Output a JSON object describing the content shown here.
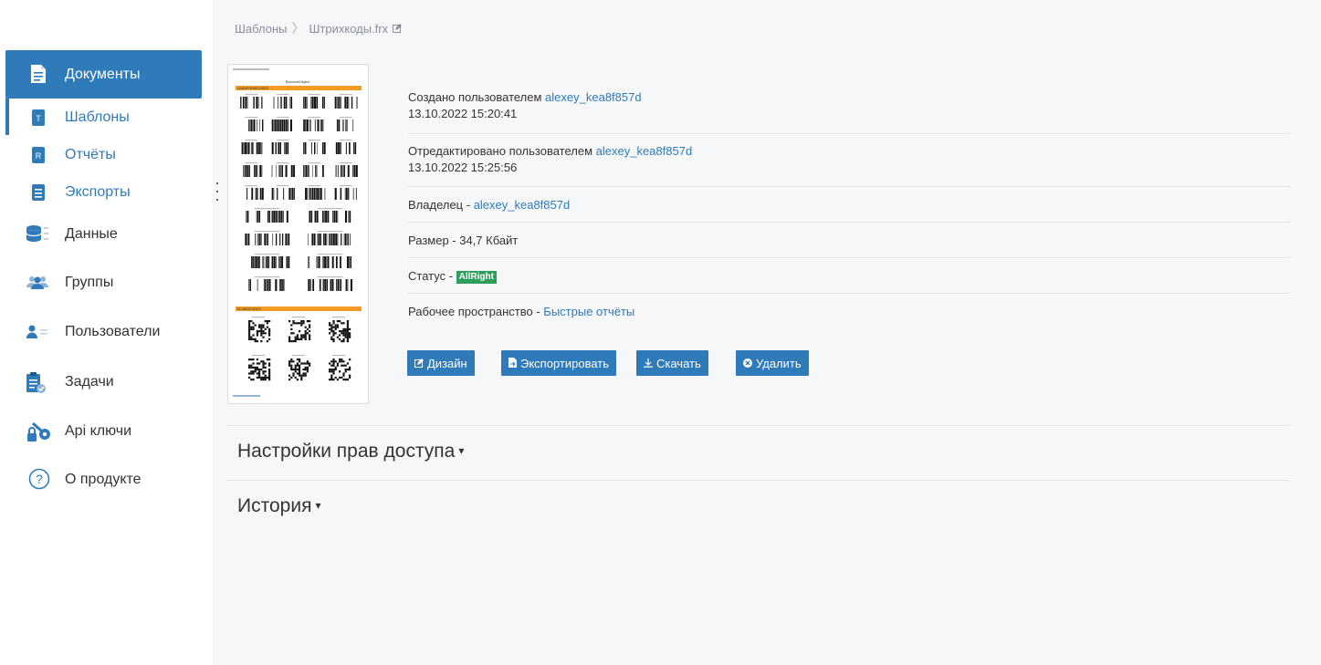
{
  "sidebar": {
    "documents": {
      "label": "Документы",
      "icon": "document-icon"
    },
    "sub_items": [
      {
        "label": "Шаблоны",
        "icon": "template-icon",
        "letter": "T"
      },
      {
        "label": "Отчёты",
        "icon": "report-icon",
        "letter": "R"
      },
      {
        "label": "Экспорты",
        "icon": "export-doc-icon"
      }
    ],
    "items": [
      {
        "label": "Данные",
        "icon": "database-icon"
      },
      {
        "label": "Группы",
        "icon": "group-icon"
      },
      {
        "label": "Пользователи",
        "icon": "users-icon"
      },
      {
        "label": "Задачи",
        "icon": "tasks-icon"
      },
      {
        "label": "Api ключи",
        "icon": "key-icon"
      },
      {
        "label": "О продукте",
        "icon": "question-icon",
        "question_mark": "?"
      }
    ]
  },
  "breadcrumb": {
    "root": "Шаблоны",
    "separator": "〉",
    "current": "Штрихкоды.frx"
  },
  "thumbnail": {
    "header": "BarcodeObject",
    "section1": "LINEAR BARCODES",
    "section2": "2D BARCODES"
  },
  "info": {
    "created_prefix": "Создано пользователем ",
    "created_user": "alexey_kea8f857d",
    "created_date": "13.10.2022 15:20:41",
    "edited_prefix": "Отредактировано пользователем ",
    "edited_user": "alexey_kea8f857d",
    "edited_date": "13.10.2022 15:25:56",
    "owner_prefix": "Владелец - ",
    "owner_user": "alexey_kea8f857d",
    "size": "Размер - 34,7 Кбайт",
    "status_prefix": "Статус - ",
    "status_badge": "AllRight",
    "workspace_prefix": "Рабочее пространство - ",
    "workspace_link": "Быстрые отчёты"
  },
  "actions": {
    "design": "Дизайн",
    "export": "Экспортировать",
    "download": "Скачать",
    "delete": "Удалить"
  },
  "sections": {
    "access": "Настройки прав доступа",
    "history": "История",
    "caret": "▾"
  },
  "colors": {
    "accent": "#2f7ab8",
    "status_green": "#2e9e5b",
    "thumb_orange": "#f39c25"
  }
}
